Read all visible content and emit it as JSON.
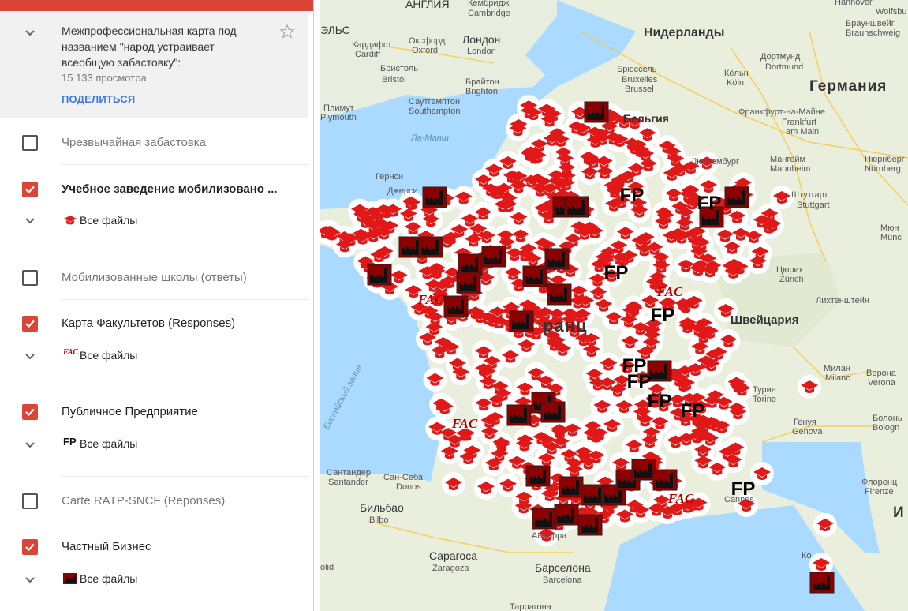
{
  "panel": {
    "header": {
      "title": "Межпрофессиональная карта под названием \"народ устраивает всеобщую забастовку\":",
      "views": "15 133 просмотра",
      "share_label": "ПОДЕЛИТЬСЯ"
    },
    "layers": [
      {
        "label": "Чрезвычайная забастовка",
        "checked": false
      },
      {
        "label": "Учебное заведение мобилизовано ...",
        "checked": true,
        "legend_icon": "graduation-cap-icon",
        "legend_label": "Все файлы"
      },
      {
        "label": "Мобилизованные школы (ответы)",
        "checked": false
      },
      {
        "label": "Карта Факультетов (Responses)",
        "checked": true,
        "legend_icon": "fac-icon",
        "legend_label": "Все файлы",
        "icon_text": "FAC"
      },
      {
        "label": "Публичное Предприятие",
        "checked": true,
        "legend_icon": "fp-icon",
        "legend_label": "Все файлы",
        "icon_text": "FP"
      },
      {
        "label": "Carte RATP-SNCF (Reponses)",
        "checked": false
      },
      {
        "label": "Частный Бизнес",
        "checked": true,
        "legend_icon": "factory-icon",
        "legend_label": "Все файлы"
      }
    ]
  },
  "map": {
    "labels": {
      "england": "АНГЛИЯ",
      "cambridge": "Кембридж",
      "cambridge_en": "Cambridge",
      "wales": "ЭЛЬС",
      "cardiff": "Кардифф",
      "cardiff_en": "Cardiff",
      "oxford": "Оксфорд",
      "oxford_en": "Oxford",
      "london": "Лондон",
      "london_en": "London",
      "bristol": "Бристоль",
      "bristol_en": "Bristol",
      "brighton": "Брайтон",
      "brighton_en": "Brighton",
      "plymouth": "Плимут",
      "plymouth_en": "Plymouth",
      "southampton": "Саутгемптон",
      "southampton_en": "Southampton",
      "channel": "Ла-Манш",
      "guernsey": "Гернси",
      "jersey": "Джерси",
      "netherlands": "Нидерланды",
      "brussels": "Брюссель",
      "brussels_fr": "Bruxelles",
      "brussels_nl": "Brussel",
      "belgium": "Бельгия",
      "luxembourg": "Люксембург",
      "dortmund": "Дортмунд",
      "dortmund_en": "Dortmund",
      "cologne": "Кёльн",
      "cologne_de": "Köln",
      "germany": "Германия",
      "frankfurt": "Франкфурт-на-Майне",
      "frankfurt_de": "Frankfurt",
      "frankfurt_de2": "am Main",
      "mannheim": "Мангейм",
      "mannheim_de": "Mannheim",
      "nuremberg": "Нюрнберг",
      "nuremberg_de": "Nürnberg",
      "stuttgart": "Штутгарт",
      "stuttgart_de": "Stuttgart",
      "munich": "Мюн",
      "munich_de": "Münc",
      "zurich": "Цюрих",
      "zurich_de": "Zürich",
      "liechtenstein": "Лихтенштейн",
      "switzerland": "Швейцария",
      "france": "ранц",
      "milan": "Милан",
      "milan_it": "Milano",
      "verona": "Верона",
      "verona_it": "Verona",
      "turin": "Турин",
      "turin_it": "Torino",
      "genoa": "Генуя",
      "genoa_it": "Genova",
      "bologna": "Болонь",
      "bologna_it": "Bologn",
      "florence": "Флоренц",
      "florence_it": "Firenze",
      "hannover": "Hannover",
      "wolfsburg": "Wolfsbu",
      "braunschweig": "Брауншвейг",
      "braunschweig_de": "Braunschweig",
      "cannes": "Cannes",
      "santander": "Сантандер",
      "santander_es": "Santander",
      "san_sebastian": "Сан-Себа",
      "san_sebastian_es": "Donos",
      "bilbao": "Бильбао",
      "bilbao_es": "Bilbo",
      "andorra": "Андорра",
      "zaragoza": "Сарагоса",
      "zaragoza_es": "Zaragoza",
      "barcelona": "Барселона",
      "barcelona_es": "Barcelona",
      "tarragona": "Таррагона",
      "valladolid": "olid",
      "corsica": "Ко",
      "biscay": "Бискайский залив",
      "italy_partial": "И"
    }
  }
}
